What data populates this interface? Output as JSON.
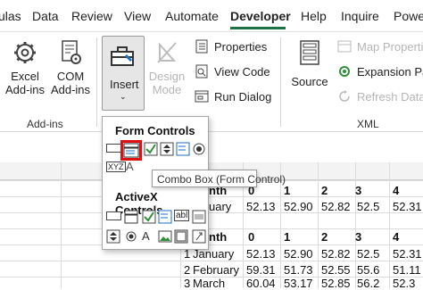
{
  "tabs": [
    {
      "label": "ulas"
    },
    {
      "label": "Data"
    },
    {
      "label": "Review"
    },
    {
      "label": "View"
    },
    {
      "label": "Automate"
    },
    {
      "label": "Developer",
      "active": true
    },
    {
      "label": "Help"
    },
    {
      "label": "Inquire"
    },
    {
      "label": "Powe"
    }
  ],
  "ribbon": {
    "excel_addins": "Excel\nAdd-ins",
    "excel_addins_l1": "Excel",
    "excel_addins_l2": "Add-ins",
    "com_addins_l1": "COM",
    "com_addins_l2": "Add-ins",
    "addins_group": "Add-ins",
    "insert": "Insert",
    "design_mode_l1": "Design",
    "design_mode_l2": "Mode",
    "properties": "Properties",
    "view_code": "View Code",
    "run_dialog": "Run Dialog",
    "source": "Source",
    "map_properties": "Map Propertie",
    "expansion_packs": "Expansion Pac",
    "refresh_data": "Refresh Data",
    "xml_group": "XML"
  },
  "dropdown": {
    "form_controls": "Form Controls",
    "activex_controls": "ActiveX Controls",
    "tooltip": "Combo Box (Form Control)"
  },
  "sheet": {
    "header1": [
      "nth",
      "0",
      "1",
      "2",
      "3",
      "4"
    ],
    "row1": [
      "uary",
      "52.13",
      "52.90",
      "52.82",
      "52.5",
      "52.31"
    ],
    "header2": [
      "nth",
      "0",
      "1",
      "2",
      "3",
      "4"
    ],
    "rows": [
      {
        "num": "1",
        "month": "January",
        "v": [
          "52.13",
          "52.90",
          "52.82",
          "52.5",
          "52.31"
        ]
      },
      {
        "num": "2",
        "month": "February",
        "v": [
          "59.31",
          "51.73",
          "52.55",
          "55.6",
          "51.11"
        ]
      },
      {
        "num": "3",
        "month": "March",
        "v": [
          "60.04",
          "53.17",
          "52.85",
          "56.2",
          "52.3"
        ]
      }
    ]
  }
}
